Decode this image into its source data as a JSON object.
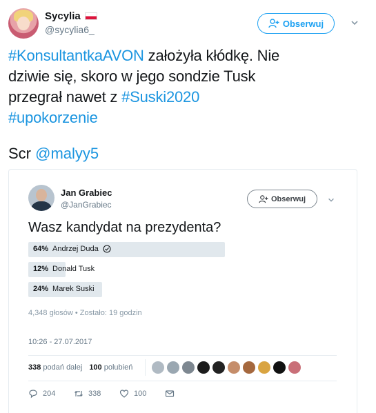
{
  "tweet": {
    "display_name": "Sycylia",
    "handle": "@sycylia6_",
    "follow_label": "Obserwuj",
    "text_lines": [
      [
        {
          "t": "#KonsultantkaAVON",
          "hl": true
        },
        {
          "t": " założyła kłódkę. Nie",
          "hl": false
        }
      ],
      [
        {
          "t": "dziwie się, skoro w jego sondzie Tusk",
          "hl": false
        }
      ],
      [
        {
          "t": "przegrał nawet z ",
          "hl": false
        },
        {
          "t": "#Suski2020",
          "hl": true
        }
      ],
      [
        {
          "t": " #upokorzenie",
          "hl": true
        }
      ]
    ],
    "scr_prefix": "Scr ",
    "scr_mention": "@malyy5"
  },
  "embedded": {
    "display_name": "Jan Grabiec",
    "handle": "@JanGrabiec",
    "follow_label": "Obserwuj",
    "question": "Wasz kandydat na prezydenta?",
    "poll": [
      {
        "percent": "64%",
        "fraction": 0.64,
        "option": "Andrzej Duda",
        "winner": true
      },
      {
        "percent": "12%",
        "fraction": 0.12,
        "option": "Donald Tusk",
        "winner": false
      },
      {
        "percent": "24%",
        "fraction": 0.24,
        "option": "Marek Suski",
        "winner": false
      }
    ],
    "meta": "4,348 głosów • Zostało: 19 godzin",
    "timestamp": "10:26 - 27.07.2017",
    "retweets_count": "338",
    "retweets_label": "podań dalej",
    "likes_count": "100",
    "likes_label": "polubień",
    "reply_count": "204",
    "retweet_action_count": "338",
    "like_action_count": "100"
  },
  "colors": {
    "link": "#1b95e0",
    "follow": "#1da1f2",
    "flag_white": "#ffffff",
    "flag_red": "#dc143c",
    "poll_fill": "#e1e8ed"
  },
  "icons": [
    "chevron-down-icon",
    "follow-person-icon",
    "verified-check-icon",
    "reply-icon",
    "retweet-icon",
    "like-icon",
    "message-icon",
    "flag-poland-icon"
  ]
}
